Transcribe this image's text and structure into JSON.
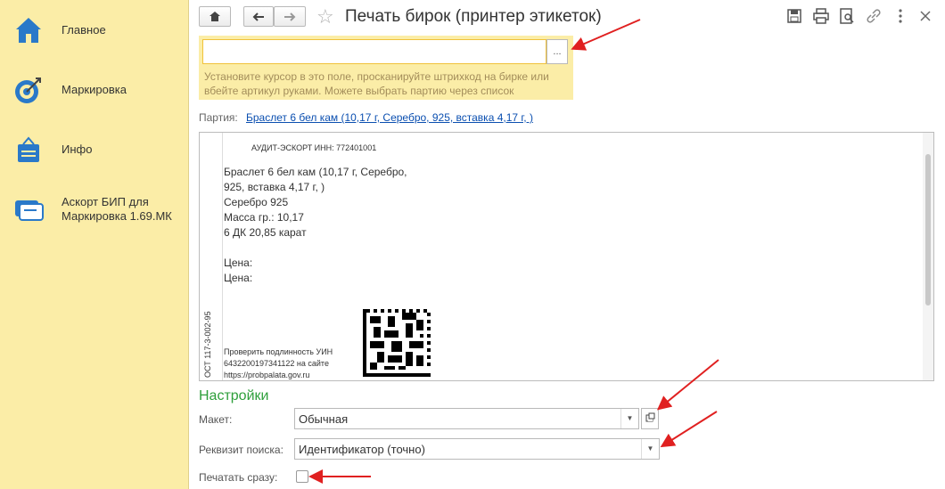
{
  "sidebar": {
    "items": [
      {
        "label": "Главное",
        "icon": "home-icon"
      },
      {
        "label": "Маркировка",
        "icon": "target-icon"
      },
      {
        "label": "Инфо",
        "icon": "info-bag-icon"
      },
      {
        "label": "Аскорт БИП для Маркировка 1.69.МК",
        "icon": "chat-icon"
      }
    ]
  },
  "header": {
    "title": "Печать бирок (принтер этикеток)",
    "icons": [
      "home-icon",
      "back-arrow-icon",
      "forward-arrow-icon",
      "star-icon",
      "save-icon",
      "print-icon",
      "preview-icon",
      "link-icon",
      "more-icon",
      "close-icon"
    ]
  },
  "scan": {
    "value": "",
    "button_label": "...",
    "hint": "Установите курсор в это поле, просканируйте штрихкод на бирке или вбейте артикул руками. Можете выбрать партию через список"
  },
  "party": {
    "label": "Партия:",
    "value": "Браслет 6 бел кам (10,17 г, Серебро, 925, вставка 4,17 г, )"
  },
  "preview": {
    "org": "АУДИТ-ЭСКОРТ ИНН: 772401001",
    "description": "Браслет 6 бел кам (10,17 г, Серебро,\n925, вставка 4,17 г, )\nСеребро 925\nМасса гр.: 10,17\n6 ДК 20,85 карат",
    "price1": "Цена:",
    "price2": "Цена:",
    "side_code": "ОСТ 117-3-002-95",
    "check_text": "Проверить подлинность УИН 643220019734112​2 на сайте https://probpalata.gov.ru"
  },
  "settings": {
    "heading": "Настройки",
    "layout_label": "Макет:",
    "layout_value": "Обычная",
    "search_label": "Реквизит поиска:",
    "search_value": "Идентификатор (точно)",
    "print_now_label": "Печатать сразу:",
    "print_now_checked": false
  },
  "colors": {
    "sidebar_bg": "#fbeda7",
    "accent_green": "#2e9f3b",
    "link": "#0b4fb0",
    "annotation_arrow": "#e02020"
  }
}
